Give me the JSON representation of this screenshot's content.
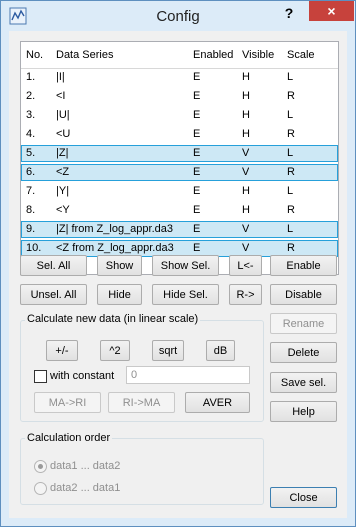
{
  "window": {
    "title": "Config",
    "help": "?",
    "close": "×"
  },
  "table": {
    "headers": [
      "No.",
      "Data Series",
      "Enabled",
      "Visible",
      "Scale"
    ],
    "rows": [
      {
        "no": "1.",
        "series": "|I|",
        "enabled": "E",
        "visible": "H",
        "scale": "L",
        "selected": false
      },
      {
        "no": "2.",
        "series": "<I",
        "enabled": "E",
        "visible": "H",
        "scale": "R",
        "selected": false
      },
      {
        "no": "3.",
        "series": "|U|",
        "enabled": "E",
        "visible": "H",
        "scale": "L",
        "selected": false
      },
      {
        "no": "4.",
        "series": "<U",
        "enabled": "E",
        "visible": "H",
        "scale": "R",
        "selected": false
      },
      {
        "no": "5.",
        "series": "|Z|",
        "enabled": "E",
        "visible": "V",
        "scale": "L",
        "selected": true
      },
      {
        "no": "6.",
        "series": "<Z",
        "enabled": "E",
        "visible": "V",
        "scale": "R",
        "selected": true
      },
      {
        "no": "7.",
        "series": "|Y|",
        "enabled": "E",
        "visible": "H",
        "scale": "L",
        "selected": false
      },
      {
        "no": "8.",
        "series": "<Y",
        "enabled": "E",
        "visible": "H",
        "scale": "R",
        "selected": false
      },
      {
        "no": "9.",
        "series": "|Z|  from Z_log_appr.da3",
        "enabled": "E",
        "visible": "V",
        "scale": "L",
        "selected": true
      },
      {
        "no": "10.",
        "series": "<Z  from Z_log_appr.da3",
        "enabled": "E",
        "visible": "V",
        "scale": "R",
        "selected": true
      }
    ]
  },
  "buttons": {
    "sel_all": "Sel. All",
    "show": "Show",
    "show_sel": "Show Sel.",
    "l_arrow": "L<-",
    "enable": "Enable",
    "unsel_all": "Unsel. All",
    "hide": "Hide",
    "hide_sel": "Hide Sel.",
    "r_arrow": "R->",
    "disable": "Disable",
    "rename": "Rename",
    "delete": "Delete",
    "save_sel": "Save sel.",
    "help": "Help",
    "close": "Close"
  },
  "calc": {
    "label": "Calculate new data (in linear scale)",
    "plus_minus": "+/-",
    "pow2": "^2",
    "sqrt": "sqrt",
    "db": "dB",
    "with_constant": "with constant",
    "constant_value": "0",
    "ma_ri": "MA->RI",
    "ri_ma": "RI->MA",
    "aver": "AVER"
  },
  "order": {
    "label": "Calculation order",
    "option1": "data1 ... data2",
    "option2": "data2 ... data1",
    "selected": "option1"
  }
}
